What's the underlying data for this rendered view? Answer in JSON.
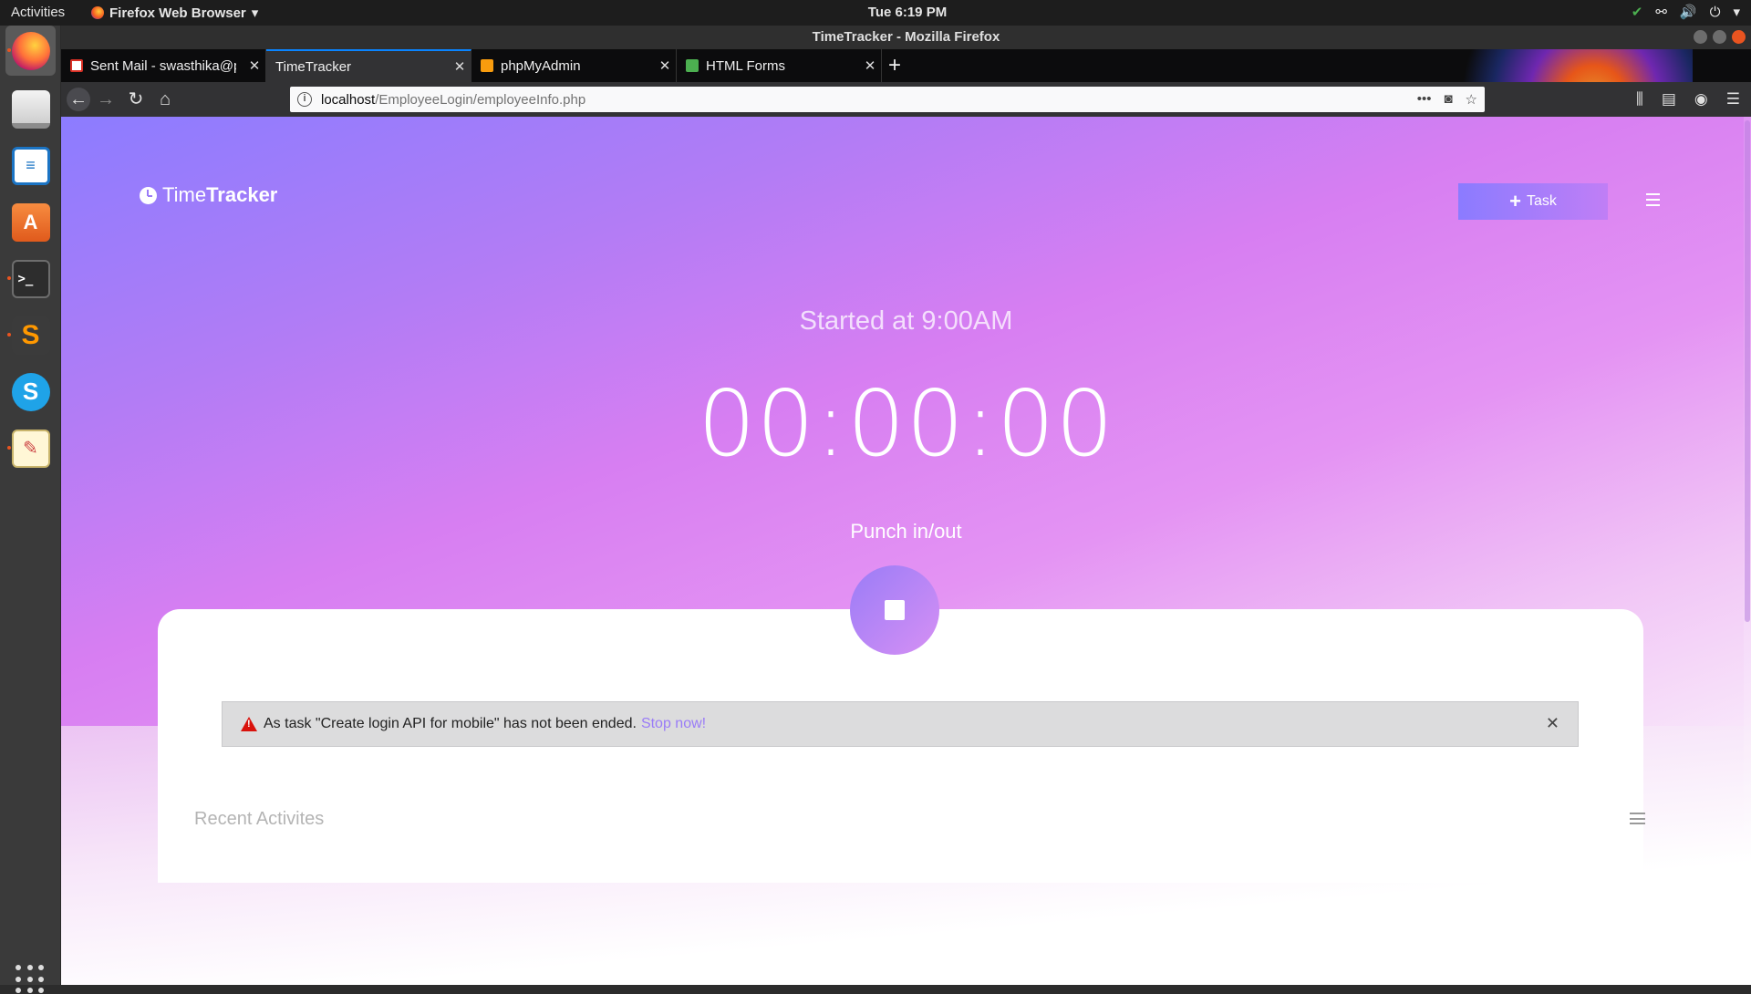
{
  "system": {
    "activities": "Activities",
    "app_menu": "Firefox Web Browser",
    "clock": "Tue  6:19 PM"
  },
  "window": {
    "title": "TimeTracker - Mozilla Firefox"
  },
  "tabs": [
    {
      "label": "Sent Mail - swasthika@p",
      "favicon": "gmail-icon",
      "color": "#d93025"
    },
    {
      "label": "TimeTracker",
      "favicon": "none",
      "color": "#323234"
    },
    {
      "label": "phpMyAdmin",
      "favicon": "phpmyadmin-icon",
      "color": "#f89c0e"
    },
    {
      "label": "HTML Forms",
      "favicon": "w3schools-icon",
      "color": "#4caf50"
    }
  ],
  "url": {
    "host": "localhost",
    "path": "/EmployeeLogin/employeeInfo.php"
  },
  "page": {
    "brand_light": "Time",
    "brand_bold": "Tracker",
    "task_button": "Task",
    "started_at": "Started at 9:00AM",
    "timer": "00:00:00",
    "punch_label": "Punch in/out",
    "alert_message": "As task \"Create login API for mobile\" has not been ended.",
    "alert_link": "Stop now!",
    "recent_title": "Recent Activites"
  },
  "colors": {
    "accent": "#9a7cf7",
    "alert_bg": "#dcdcdd",
    "warning": "#d9120c"
  }
}
